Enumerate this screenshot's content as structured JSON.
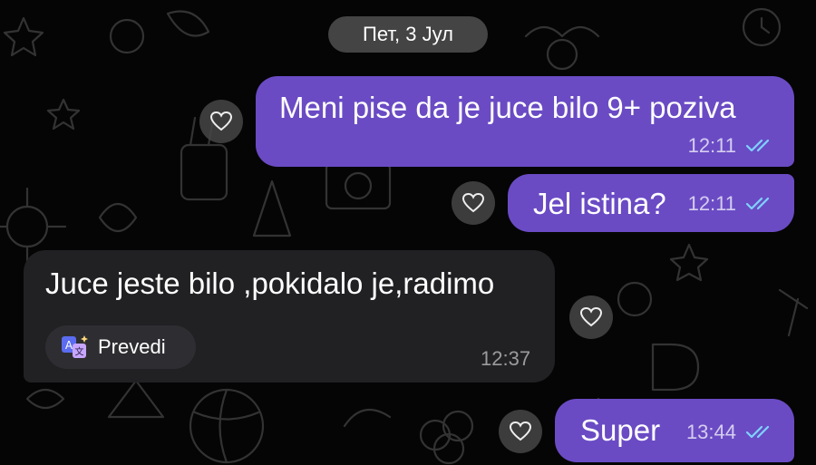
{
  "chat": {
    "date_label": "Пет, 3 Јул",
    "messages": [
      {
        "direction": "outgoing",
        "text": "Meni pise da je juce bilo 9+ poziva",
        "time": "12:11",
        "status": "read"
      },
      {
        "direction": "outgoing",
        "text": "Jel istina?",
        "time": "12:11",
        "status": "read"
      },
      {
        "direction": "incoming",
        "text": "Juce jeste bilo ,pokidalo je,radimo",
        "time": "12:37",
        "translate_label": "Prevedi"
      },
      {
        "direction": "outgoing",
        "text": "Super",
        "time": "13:44",
        "status": "read"
      }
    ]
  },
  "colors": {
    "background": "#050505",
    "outgoing_bubble": "#6a4bc4",
    "incoming_bubble": "#212124",
    "read_ticks": "#7fd3ff"
  },
  "icons": {
    "reaction": "heart-icon",
    "read_status": "double-check-icon",
    "translate": "translate-icon"
  }
}
